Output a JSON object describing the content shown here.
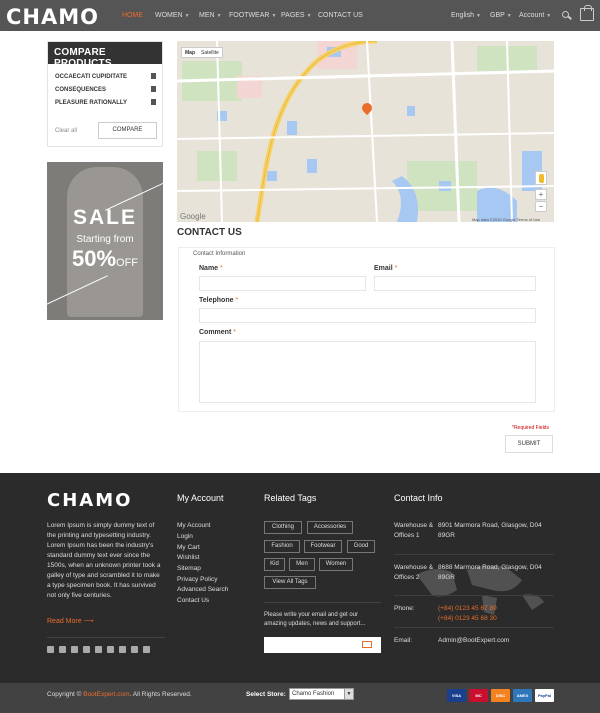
{
  "header": {
    "logo": "CHAMO",
    "nav": [
      {
        "label": "HOME",
        "active": true
      },
      {
        "label": "WOMEN"
      },
      {
        "label": "MEN"
      },
      {
        "label": "FOOTWEAR"
      },
      {
        "label": "PAGES"
      },
      {
        "label": "CONTACT US"
      }
    ],
    "language": "English",
    "currency": "GBP",
    "account": "Account",
    "accent_color": "#e96d2a"
  },
  "compare": {
    "title": "COMPARE PRODUCTS",
    "items": [
      "OCCAECATI CUPIDITATE",
      "CONSEQUENCES",
      "PLEASURE RATIONALLY"
    ],
    "clear_all": "Clear all",
    "compare_button": "COMPARE"
  },
  "banner": {
    "sale": "SALE",
    "starting": "Starting from",
    "percent": "50%",
    "off": "OFF"
  },
  "map": {
    "tab_map": "Map",
    "tab_satellite": "Satellite",
    "footer": "Map data ©2015 Google    Terms of Use",
    "google": "Google"
  },
  "contact": {
    "title": "CONTACT US",
    "section": "Contact Information",
    "name_label": "Name",
    "email_label": "Email",
    "telephone_label": "Telephone",
    "comment_label": "Comment",
    "required_star": "*",
    "required_note": "*Required Fields",
    "submit": "SUBMIT"
  },
  "footer": {
    "logo": "CHAMO",
    "description": "Lorem Ipsum is simply dummy text of the printing and typesetting industry. Lorem Ipsum has been the industry's standard dummy text ever since the 1500s, when an unknown printer took a galley of type and scrambled it to make a type specimen book. It has survived not only five centuries.",
    "read_more": "Read More",
    "social_icons": [
      "facebook-icon",
      "twitter-icon",
      "instagram-icon",
      "linkedin-icon",
      "flickr-icon",
      "pinterest-icon",
      "google-plus-icon",
      "tumblr-icon",
      "vimeo-icon"
    ],
    "my_account": {
      "title": "My Account",
      "links": [
        "My Account",
        "Login",
        "My Cart",
        "Wishlist",
        "Sitemap",
        "Privacy Policy",
        "Advanced Search",
        "Contact Us"
      ]
    },
    "related_tags": {
      "title": "Related Tags",
      "tags": [
        "Clothing",
        "Accessories",
        "Fashion",
        "Footwear",
        "Good",
        "Kid",
        "Men",
        "Women",
        "View All Tags"
      ]
    },
    "newsletter_text": "Please write your email and get our amazing updates, news and support...",
    "contact_info": {
      "title": "Contact Info",
      "warehouse1_label": "Warehouse & Offices 1",
      "warehouse1_address": "8901 Marmora Road, Glasgow, D04 89GR",
      "warehouse2_label": "Warehouse & Offices 2",
      "warehouse2_address": "8688 Marmora Road, Glasgow, D04 89GR",
      "phone_label": "Phone:",
      "phone1": "(+84) 0123 45 67 89",
      "phone2": "(+84) 0123 45 68 30",
      "email_label": "Email:",
      "email": "Admin@BootExpert.com"
    }
  },
  "bottom": {
    "copyright_prefix": "Copyright © ",
    "brand": "BootExpert.com",
    "copyright_suffix": ". All Rights Reserved.",
    "select_store": "Select Store:",
    "store_value": "Chamo Fashion",
    "payments": [
      "VISA",
      "MC",
      "DISC",
      "AMEX",
      "PayPal"
    ]
  }
}
